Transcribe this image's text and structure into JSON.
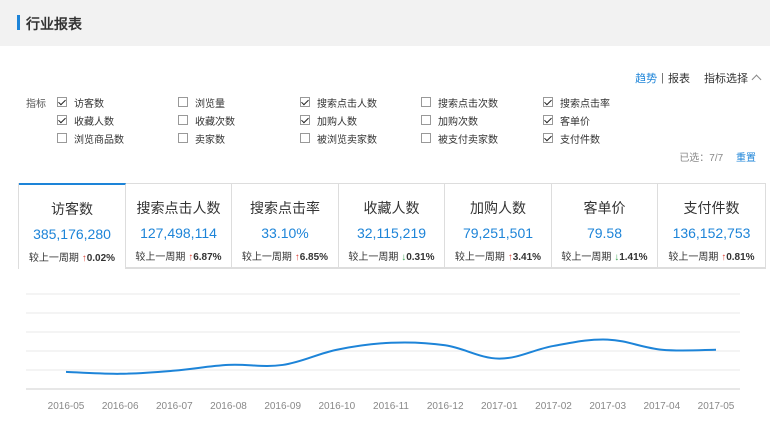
{
  "header": {
    "title": "行业报表"
  },
  "topright": {
    "trend": "趋势",
    "separator": "|",
    "report": "报表",
    "indicator_select": "指标选择"
  },
  "metrics_label": "指标",
  "metrics": [
    {
      "label": "访客数",
      "checked": true
    },
    {
      "label": "浏览量",
      "checked": false
    },
    {
      "label": "搜索点击人数",
      "checked": true
    },
    {
      "label": "搜索点击次数",
      "checked": false
    },
    {
      "label": "搜索点击率",
      "checked": true
    },
    {
      "label": "收藏人数",
      "checked": true
    },
    {
      "label": "收藏次数",
      "checked": false
    },
    {
      "label": "加购人数",
      "checked": true
    },
    {
      "label": "加购次数",
      "checked": false
    },
    {
      "label": "客单价",
      "checked": true
    },
    {
      "label": "浏览商品数",
      "checked": false
    },
    {
      "label": "卖家数",
      "checked": false
    },
    {
      "label": "被浏览卖家数",
      "checked": false
    },
    {
      "label": "被支付卖家数",
      "checked": false
    },
    {
      "label": "支付件数",
      "checked": true
    }
  ],
  "selection": {
    "selected_text": "已选：7/7",
    "reset_label": "重置"
  },
  "compare_label": "较上一周期",
  "cards": [
    {
      "name": "访客数",
      "value": "385,176,280",
      "change": "0.02%",
      "direction": "up"
    },
    {
      "name": "搜索点击人数",
      "value": "127,498,114",
      "change": "6.87%",
      "direction": "up"
    },
    {
      "name": "搜索点击率",
      "value": "33.10%",
      "change": "6.85%",
      "direction": "up"
    },
    {
      "name": "收藏人数",
      "value": "32,115,219",
      "change": "0.31%",
      "direction": "down"
    },
    {
      "name": "加购人数",
      "value": "79,251,501",
      "change": "3.41%",
      "direction": "up"
    },
    {
      "name": "客单价",
      "value": "79.58",
      "change": "1.41%",
      "direction": "down"
    },
    {
      "name": "支付件数",
      "value": "136,152,753",
      "change": "0.81%",
      "direction": "up"
    }
  ],
  "colors": {
    "accent": "#1d84d8",
    "up": "#e0463a",
    "down": "#3aa651"
  },
  "chart_data": {
    "type": "line",
    "x": [
      "2016-05",
      "2016-06",
      "2016-07",
      "2016-08",
      "2016-09",
      "2016-10",
      "2016-11",
      "2016-12",
      "2017-01",
      "2017-02",
      "2017-03",
      "2017-04",
      "2017-05"
    ],
    "series": [
      {
        "values": [
          0.27,
          0.24,
          0.29,
          0.38,
          0.38,
          0.62,
          0.73,
          0.69,
          0.48,
          0.68,
          0.78,
          0.62,
          0.62
        ]
      }
    ],
    "ylim": [
      0,
      1.5
    ],
    "grid": true,
    "title": "",
    "xlabel": "",
    "ylabel": ""
  }
}
